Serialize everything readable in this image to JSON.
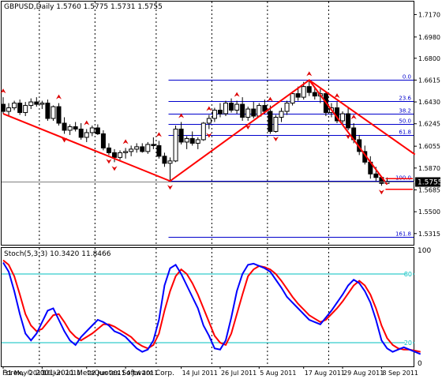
{
  "main": {
    "header": "GBPUSD,Daily  1.5760 1.5775 1.5731 1.5755",
    "price_ticks": [
      "1.7170",
      "1.6980",
      "1.6800",
      "1.6615",
      "1.6430",
      "1.6245",
      "1.6055",
      "1.5870",
      "1.5685",
      "1.5500",
      "1.5315"
    ],
    "price_badge": "1.5755",
    "fib_levels": [
      {
        "label": "0.0",
        "price": 1.6615
      },
      {
        "label": "23.6",
        "price": 1.6438
      },
      {
        "label": "38.2",
        "price": 1.6327
      },
      {
        "label": "50.0",
        "price": 1.624
      },
      {
        "label": "61.8",
        "price": 1.6147
      },
      {
        "label": "100.0",
        "price": 1.5765
      },
      {
        "label": "161.8",
        "price": 1.529
      }
    ]
  },
  "sub": {
    "header": "Stoch(5,3,3) 10.3420 11.8466",
    "ticks": [
      "100",
      "0"
    ],
    "level_labels": [
      "80",
      "20"
    ],
    "levels": [
      80,
      20
    ]
  },
  "date_labels": [
    "31 May 2011",
    "10 Jun 2011",
    "22 Jun 2011",
    "4 Jul 2011",
    "14 Jul 2011",
    "26 Jul 2011",
    "5 Aug 2011",
    "17 Aug 2011",
    "29 Aug 2011",
    "8 Sep 2011"
  ],
  "copyright": "Forex, © 2001-2011 MetaQuotes Software Corp.",
  "colors": {
    "bg": "#ffffff",
    "candle": "#000000",
    "zigzag": "#ff0000",
    "fib": "#0000cc",
    "stoch_main": "#0000ff",
    "stoch_signal": "#ff0000",
    "level": "#00bfbf",
    "grid": "#000000",
    "fractal": "#dd0000",
    "badge": "#ffffff"
  },
  "chart_data": [
    {
      "type": "candlestick",
      "title": "GBPUSD,Daily",
      "ylim": [
        1.522,
        1.728
      ],
      "close_line": 1.5755,
      "candles": [
        {
          "o": 1.641,
          "h": 1.647,
          "l": 1.633,
          "c": 1.635
        },
        {
          "o": 1.635,
          "h": 1.642,
          "l": 1.631,
          "c": 1.638
        },
        {
          "o": 1.638,
          "h": 1.644,
          "l": 1.636,
          "c": 1.642
        },
        {
          "o": 1.642,
          "h": 1.645,
          "l": 1.632,
          "c": 1.634
        },
        {
          "o": 1.634,
          "h": 1.643,
          "l": 1.631,
          "c": 1.64
        },
        {
          "o": 1.64,
          "h": 1.646,
          "l": 1.637,
          "c": 1.643
        },
        {
          "o": 1.643,
          "h": 1.647,
          "l": 1.639,
          "c": 1.641
        },
        {
          "o": 1.641,
          "h": 1.644,
          "l": 1.637,
          "c": 1.642
        },
        {
          "o": 1.642,
          "h": 1.645,
          "l": 1.627,
          "c": 1.629
        },
        {
          "o": 1.629,
          "h": 1.64,
          "l": 1.627,
          "c": 1.639
        },
        {
          "o": 1.639,
          "h": 1.642,
          "l": 1.623,
          "c": 1.625
        },
        {
          "o": 1.625,
          "h": 1.63,
          "l": 1.616,
          "c": 1.619
        },
        {
          "o": 1.619,
          "h": 1.624,
          "l": 1.615,
          "c": 1.622
        },
        {
          "o": 1.622,
          "h": 1.626,
          "l": 1.618,
          "c": 1.62
        },
        {
          "o": 1.62,
          "h": 1.625,
          "l": 1.611,
          "c": 1.613
        },
        {
          "o": 1.613,
          "h": 1.62,
          "l": 1.609,
          "c": 1.617
        },
        {
          "o": 1.617,
          "h": 1.623,
          "l": 1.614,
          "c": 1.621
        },
        {
          "o": 1.621,
          "h": 1.624,
          "l": 1.615,
          "c": 1.616
        },
        {
          "o": 1.616,
          "h": 1.619,
          "l": 1.602,
          "c": 1.604
        },
        {
          "o": 1.604,
          "h": 1.608,
          "l": 1.598,
          "c": 1.6
        },
        {
          "o": 1.6,
          "h": 1.603,
          "l": 1.592,
          "c": 1.596
        },
        {
          "o": 1.596,
          "h": 1.602,
          "l": 1.594,
          "c": 1.6
        },
        {
          "o": 1.6,
          "h": 1.604,
          "l": 1.595,
          "c": 1.601
        },
        {
          "o": 1.601,
          "h": 1.606,
          "l": 1.597,
          "c": 1.603
        },
        {
          "o": 1.603,
          "h": 1.608,
          "l": 1.6,
          "c": 1.605
        },
        {
          "o": 1.605,
          "h": 1.608,
          "l": 1.6,
          "c": 1.601
        },
        {
          "o": 1.601,
          "h": 1.609,
          "l": 1.599,
          "c": 1.607
        },
        {
          "o": 1.607,
          "h": 1.613,
          "l": 1.603,
          "c": 1.606
        },
        {
          "o": 1.606,
          "h": 1.61,
          "l": 1.595,
          "c": 1.597
        },
        {
          "o": 1.597,
          "h": 1.6,
          "l": 1.588,
          "c": 1.591
        },
        {
          "o": 1.591,
          "h": 1.596,
          "l": 1.576,
          "c": 1.593
        },
        {
          "o": 1.593,
          "h": 1.623,
          "l": 1.592,
          "c": 1.62
        },
        {
          "o": 1.62,
          "h": 1.626,
          "l": 1.607,
          "c": 1.609
        },
        {
          "o": 1.609,
          "h": 1.614,
          "l": 1.603,
          "c": 1.612
        },
        {
          "o": 1.612,
          "h": 1.618,
          "l": 1.606,
          "c": 1.608
        },
        {
          "o": 1.608,
          "h": 1.613,
          "l": 1.603,
          "c": 1.611
        },
        {
          "o": 1.611,
          "h": 1.626,
          "l": 1.61,
          "c": 1.625
        },
        {
          "o": 1.625,
          "h": 1.632,
          "l": 1.62,
          "c": 1.629
        },
        {
          "o": 1.629,
          "h": 1.638,
          "l": 1.626,
          "c": 1.636
        },
        {
          "o": 1.636,
          "h": 1.642,
          "l": 1.63,
          "c": 1.633
        },
        {
          "o": 1.633,
          "h": 1.644,
          "l": 1.631,
          "c": 1.642
        },
        {
          "o": 1.642,
          "h": 1.646,
          "l": 1.634,
          "c": 1.636
        },
        {
          "o": 1.636,
          "h": 1.644,
          "l": 1.633,
          "c": 1.641
        },
        {
          "o": 1.641,
          "h": 1.647,
          "l": 1.627,
          "c": 1.63
        },
        {
          "o": 1.63,
          "h": 1.639,
          "l": 1.627,
          "c": 1.637
        },
        {
          "o": 1.637,
          "h": 1.643,
          "l": 1.629,
          "c": 1.631
        },
        {
          "o": 1.631,
          "h": 1.642,
          "l": 1.63,
          "c": 1.64
        },
        {
          "o": 1.64,
          "h": 1.645,
          "l": 1.633,
          "c": 1.635
        },
        {
          "o": 1.635,
          "h": 1.64,
          "l": 1.616,
          "c": 1.618
        },
        {
          "o": 1.618,
          "h": 1.632,
          "l": 1.617,
          "c": 1.63
        },
        {
          "o": 1.63,
          "h": 1.638,
          "l": 1.626,
          "c": 1.635
        },
        {
          "o": 1.635,
          "h": 1.644,
          "l": 1.632,
          "c": 1.642
        },
        {
          "o": 1.642,
          "h": 1.652,
          "l": 1.64,
          "c": 1.65
        },
        {
          "o": 1.65,
          "h": 1.656,
          "l": 1.644,
          "c": 1.647
        },
        {
          "o": 1.647,
          "h": 1.66,
          "l": 1.645,
          "c": 1.656
        },
        {
          "o": 1.656,
          "h": 1.6615,
          "l": 1.648,
          "c": 1.651
        },
        {
          "o": 1.651,
          "h": 1.656,
          "l": 1.645,
          "c": 1.648
        },
        {
          "o": 1.648,
          "h": 1.654,
          "l": 1.642,
          "c": 1.65
        },
        {
          "o": 1.65,
          "h": 1.652,
          "l": 1.631,
          "c": 1.634
        },
        {
          "o": 1.634,
          "h": 1.642,
          "l": 1.63,
          "c": 1.638
        },
        {
          "o": 1.638,
          "h": 1.643,
          "l": 1.625,
          "c": 1.627
        },
        {
          "o": 1.627,
          "h": 1.635,
          "l": 1.623,
          "c": 1.633
        },
        {
          "o": 1.633,
          "h": 1.638,
          "l": 1.619,
          "c": 1.621
        },
        {
          "o": 1.621,
          "h": 1.625,
          "l": 1.608,
          "c": 1.611
        },
        {
          "o": 1.611,
          "h": 1.615,
          "l": 1.598,
          "c": 1.601
        },
        {
          "o": 1.601,
          "h": 1.606,
          "l": 1.59,
          "c": 1.592
        },
        {
          "o": 1.592,
          "h": 1.597,
          "l": 1.578,
          "c": 1.582
        },
        {
          "o": 1.582,
          "h": 1.588,
          "l": 1.576,
          "c": 1.579
        },
        {
          "o": 1.579,
          "h": 1.579,
          "l": 1.572,
          "c": 1.574
        },
        {
          "o": 1.574,
          "h": 1.579,
          "l": 1.5731,
          "c": 1.5755
        }
      ],
      "zigzag": [
        {
          "bar": 0,
          "price": 1.633
        },
        {
          "bar": 30,
          "price": 1.576
        },
        {
          "bar": 55,
          "price": 1.6615
        },
        {
          "bar": 69,
          "price": 1.5731
        }
      ],
      "channel_line": [
        {
          "bar": 55,
          "price": 1.6615
        },
        {
          "bar": 74,
          "price": 1.5985
        }
      ],
      "fib_anchor_bar": 30,
      "fractals_up": [
        0,
        10,
        15,
        22,
        28,
        32,
        37,
        42,
        48,
        55,
        60,
        63
      ],
      "fractals_down": [
        11,
        19,
        20,
        30,
        37,
        44,
        49,
        62,
        68
      ]
    },
    {
      "type": "line",
      "title": "Stoch(5,3,3)",
      "ylim": [
        0,
        100
      ],
      "series": [
        {
          "name": "Main",
          "values": [
            90,
            82,
            65,
            45,
            28,
            22,
            28,
            38,
            48,
            50,
            40,
            30,
            22,
            18,
            25,
            30,
            35,
            40,
            38,
            35,
            30,
            28,
            25,
            20,
            15,
            12,
            14,
            22,
            40,
            70,
            85,
            88,
            80,
            70,
            60,
            50,
            35,
            26,
            15,
            14,
            22,
            42,
            65,
            80,
            88,
            89,
            87,
            85,
            82,
            75,
            68,
            60,
            55,
            50,
            45,
            40,
            38,
            36,
            42,
            48,
            55,
            62,
            70,
            75,
            72,
            65,
            55,
            40,
            22,
            15,
            12,
            14,
            16,
            14,
            12,
            10
          ]
        },
        {
          "name": "Signal",
          "values": [
            92,
            88,
            78,
            62,
            45,
            35,
            30,
            32,
            38,
            44,
            45,
            38,
            30,
            25,
            22,
            25,
            28,
            32,
            36,
            36,
            34,
            31,
            28,
            25,
            20,
            17,
            15,
            18,
            28,
            48,
            65,
            78,
            84,
            80,
            72,
            62,
            50,
            38,
            26,
            20,
            18,
            28,
            45,
            62,
            78,
            84,
            87,
            86,
            84,
            80,
            74,
            67,
            60,
            54,
            49,
            44,
            41,
            38,
            40,
            45,
            50,
            56,
            63,
            70,
            74,
            70,
            62,
            50,
            35,
            24,
            18,
            15,
            14,
            14,
            13,
            12
          ]
        }
      ]
    }
  ]
}
